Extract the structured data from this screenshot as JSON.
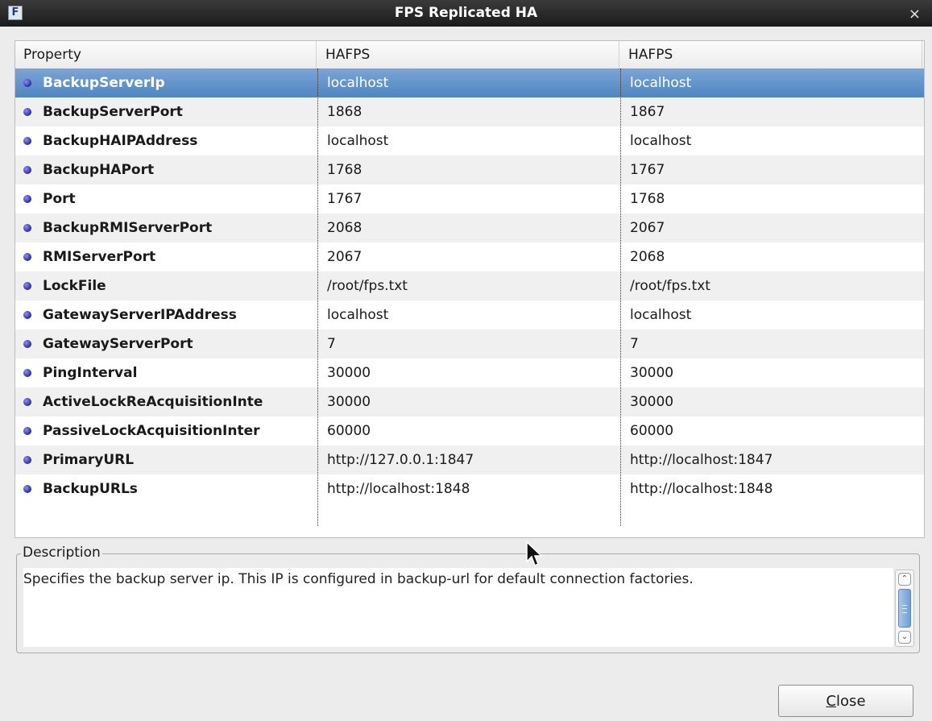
{
  "window": {
    "title": "FPS Replicated HA",
    "icon": "app-logo-icon",
    "close_glyph": "×"
  },
  "table": {
    "columns": [
      "Property",
      "HAFPS",
      "HAFPS"
    ],
    "selected_row": 0,
    "rows": [
      {
        "property": "BackupServerIp",
        "v1": "localhost",
        "v2": "localhost"
      },
      {
        "property": "BackupServerPort",
        "v1": "1868",
        "v2": "1867"
      },
      {
        "property": "BackupHAIPAddress",
        "v1": "localhost",
        "v2": "localhost"
      },
      {
        "property": "BackupHAPort",
        "v1": "1768",
        "v2": "1767"
      },
      {
        "property": "Port",
        "v1": "1767",
        "v2": "1768"
      },
      {
        "property": "BackupRMIServerPort",
        "v1": "2068",
        "v2": "2067"
      },
      {
        "property": "RMIServerPort",
        "v1": "2067",
        "v2": "2068"
      },
      {
        "property": "LockFile",
        "v1": "/root/fps.txt",
        "v2": "/root/fps.txt"
      },
      {
        "property": "GatewayServerIPAddress",
        "v1": "localhost",
        "v2": "localhost"
      },
      {
        "property": "GatewayServerPort",
        "v1": "7",
        "v2": "7"
      },
      {
        "property": "PingInterval",
        "v1": "30000",
        "v2": "30000"
      },
      {
        "property": "ActiveLockReAcquisitionInte",
        "v1": "30000",
        "v2": "30000"
      },
      {
        "property": "PassiveLockAcquisitionInter",
        "v1": "60000",
        "v2": "60000"
      },
      {
        "property": "PrimaryURL",
        "v1": "http://127.0.0.1:1847",
        "v2": "http://localhost:1847"
      },
      {
        "property": "BackupURLs",
        "v1": "http://localhost:1848",
        "v2": "http://localhost:1848"
      }
    ]
  },
  "description": {
    "label": "Description",
    "text": "Specifies the backup server ip. This IP is configured in backup-url for default connection factories."
  },
  "buttons": {
    "close_mnemonic": "C",
    "close_rest": "lose"
  },
  "colors": {
    "selection": "#5b8dc8",
    "titlebar": "#2a2a2a",
    "bullet": "#3535b5"
  }
}
